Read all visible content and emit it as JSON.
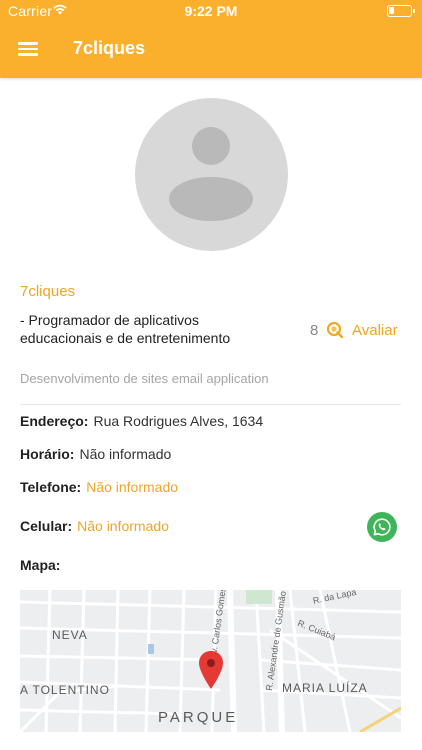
{
  "status_bar": {
    "carrier": "Carrier",
    "time": "9:22 PM"
  },
  "header": {
    "title": "7cliques",
    "menu_icon": "hamburger-menu-icon"
  },
  "profile": {
    "name": "7cliques",
    "description": "- Programador de aplicativos educacionais e de entretenimento",
    "rating_count": "8",
    "rate_label": "Avaliar",
    "tagline": "Desenvolvimento de sites email application"
  },
  "info": {
    "address_label": "Endereço:",
    "address_value": "Rua Rodrigues Alves, 1634",
    "hours_label": "Horário:",
    "hours_value": "Não informado",
    "phone_label": "Telefone:",
    "phone_value": "Não informado",
    "mobile_label": "Celular:",
    "mobile_value": "Não informado",
    "map_label": "Mapa:"
  },
  "map": {
    "neighborhoods": [
      "NEVA",
      "A TOLENTINO",
      "MARIA LUÍZA",
      "PARQUE"
    ],
    "streets": [
      "Av. Carlos Gomes",
      "R. Alexandre de Gusmão",
      "R. Cuiabá",
      "R. da Lapa"
    ]
  },
  "colors": {
    "accent": "#fbb02d",
    "link": "#f0a526",
    "whatsapp": "#3fb559",
    "pin": "#e53935"
  }
}
